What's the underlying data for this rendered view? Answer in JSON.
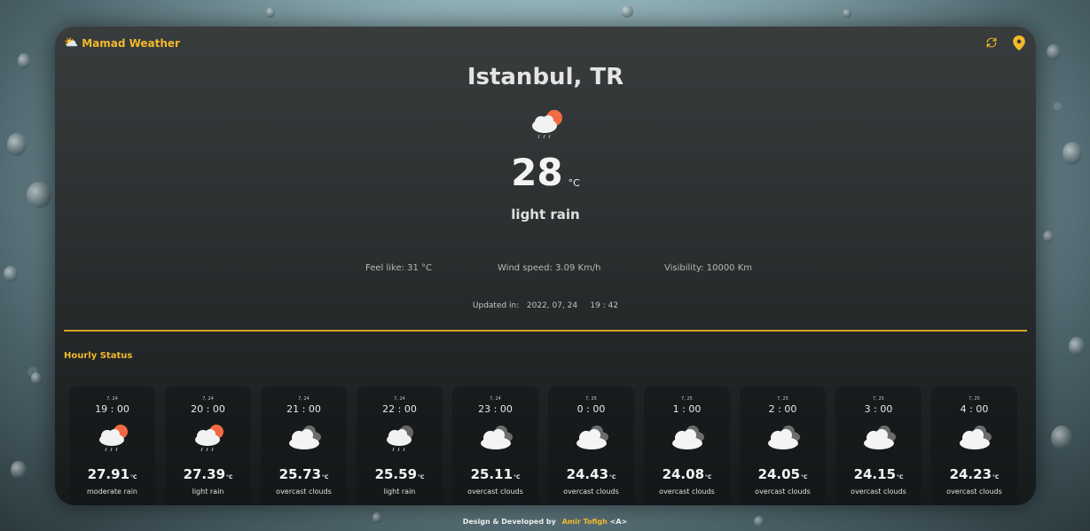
{
  "brand": {
    "name": "Mamad Weather",
    "icon": "sun-cloud-icon"
  },
  "actions": {
    "refresh_icon": "refresh-icon",
    "location_icon": "location-pin-icon"
  },
  "accent_color": "#f2b92b",
  "current": {
    "city": "Istanbul, TR",
    "icon": "rain-cloud-sun-icon",
    "temp": "28",
    "unit": "°C",
    "description": "light rain",
    "feel_like": "Feel like: 31 °C",
    "wind_speed": "Wind speed: 3.09 Km/h",
    "visibility": "Visibility: 10000 Km",
    "updated": "Updated in:   2022, 07, 24     19 : 42"
  },
  "hourly": {
    "title": "Hourly Status",
    "items": [
      {
        "date": "7, 24",
        "time": "19 : 00",
        "temp": "27.91",
        "unit": "°C",
        "desc": "moderate rain",
        "icon": "rain-sun-icon"
      },
      {
        "date": "7, 24",
        "time": "20 : 00",
        "temp": "27.39",
        "unit": "°C",
        "desc": "light rain",
        "icon": "rain-sun-icon"
      },
      {
        "date": "7, 24",
        "time": "21 : 00",
        "temp": "25.73",
        "unit": "°C",
        "desc": "overcast clouds",
        "icon": "clouds-icon"
      },
      {
        "date": "7, 24",
        "time": "22 : 00",
        "temp": "25.59",
        "unit": "°C",
        "desc": "light rain",
        "icon": "rain-cloud-icon"
      },
      {
        "date": "7, 24",
        "time": "23 : 00",
        "temp": "25.11",
        "unit": "°C",
        "desc": "overcast clouds",
        "icon": "clouds-icon"
      },
      {
        "date": "7, 25",
        "time": "0 : 00",
        "temp": "24.43",
        "unit": "°C",
        "desc": "overcast clouds",
        "icon": "clouds-icon"
      },
      {
        "date": "7, 25",
        "time": "1 : 00",
        "temp": "24.08",
        "unit": "°C",
        "desc": "overcast clouds",
        "icon": "clouds-icon"
      },
      {
        "date": "7, 25",
        "time": "2 : 00",
        "temp": "24.05",
        "unit": "°C",
        "desc": "overcast clouds",
        "icon": "clouds-icon"
      },
      {
        "date": "7, 25",
        "time": "3 : 00",
        "temp": "24.15",
        "unit": "°C",
        "desc": "overcast clouds",
        "icon": "clouds-icon"
      },
      {
        "date": "7, 25",
        "time": "4 : 00",
        "temp": "24.23",
        "unit": "°C",
        "desc": "overcast clouds",
        "icon": "clouds-icon"
      }
    ]
  },
  "footer": {
    "text": "Design & Developed by",
    "author": "Amir Tofigh",
    "suffix": "<A>"
  }
}
